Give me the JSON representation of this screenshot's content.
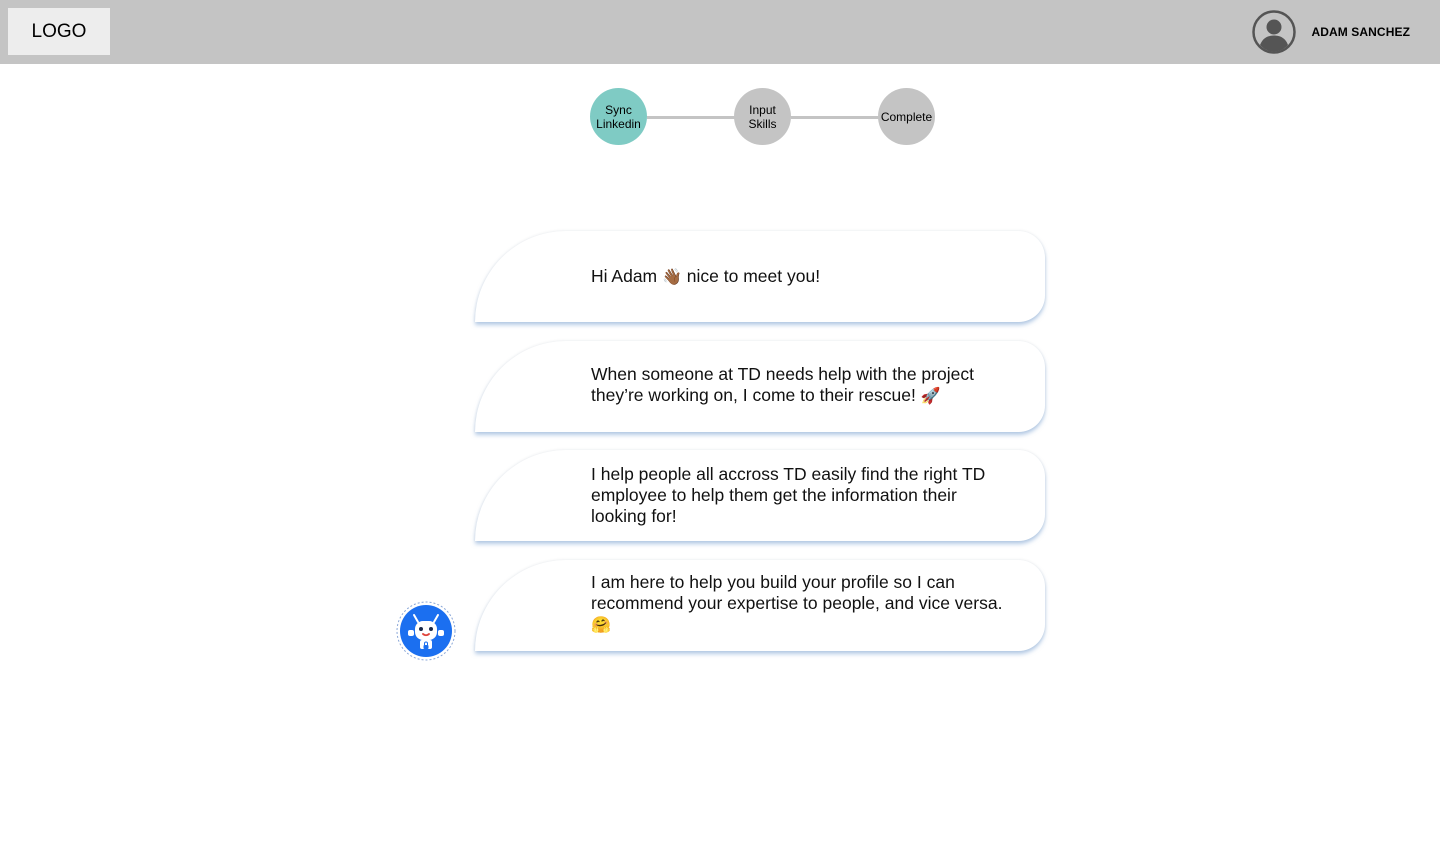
{
  "header": {
    "logo": "LOGO",
    "user_name": "ADAM SANCHEZ",
    "avatar_icon": "user-avatar-icon"
  },
  "stepper": {
    "steps": [
      {
        "label": "Sync\nLinkedin",
        "state": "active"
      },
      {
        "label": "Input\nSkills",
        "state": "pending"
      },
      {
        "label": "Complete",
        "state": "pending"
      }
    ]
  },
  "chat": {
    "messages": [
      {
        "text_before": "Hi Adam ",
        "emoji": "👋🏾",
        "text_after": " nice to meet you!"
      },
      {
        "text_before": "When someone at TD needs help with the project they’re working on, I come to their rescue! ",
        "emoji": "🚀",
        "text_after": ""
      },
      {
        "text_before": "I help people all accross TD easily find the right TD employee to help them get the information their looking for!",
        "emoji": "",
        "text_after": ""
      },
      {
        "text_before": "I am here to help you build your profile so I can recommend your expertise to people, and vice versa. ",
        "emoji": "🤗",
        "text_after": ""
      }
    ],
    "bot_icon": "robot-icon"
  },
  "colors": {
    "header_bg": "#c4c4c4",
    "logo_bg": "#ededed",
    "step_active": "#7fcbc4",
    "step_pending": "#c4c4c4",
    "bot_blue": "#1b6ff0"
  }
}
